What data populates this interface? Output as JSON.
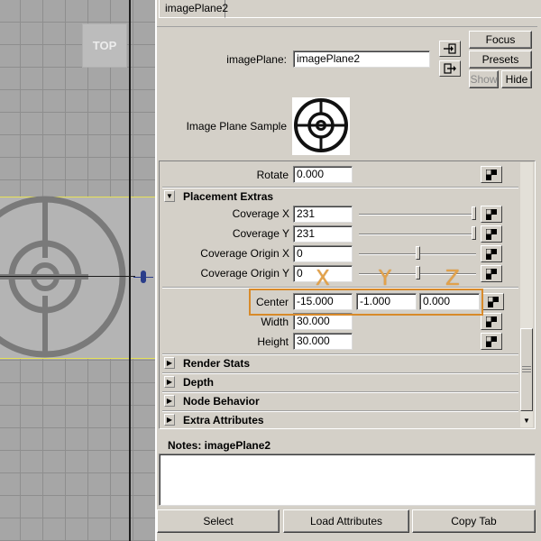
{
  "viewport": {
    "camera_label": "TOP"
  },
  "tab": {
    "label": "imagePlane2"
  },
  "header": {
    "node_label": "imagePlane:",
    "node_value": "imagePlane2",
    "focus_label": "Focus",
    "presets_label": "Presets",
    "show_label": "Show",
    "hide_label": "Hide",
    "sample_label": "Image Plane Sample"
  },
  "attributes": {
    "rotate": {
      "label": "Rotate",
      "value": "0.000"
    },
    "placement_extras": {
      "title": "Placement Extras",
      "expanded": true,
      "rows": [
        {
          "label": "Coverage X",
          "value": "231",
          "slider": 1.0
        },
        {
          "label": "Coverage Y",
          "value": "231",
          "slider": 1.0
        },
        {
          "label": "Coverage Origin X",
          "value": "0",
          "slider": 0.5
        },
        {
          "label": "Coverage Origin Y",
          "value": "0",
          "slider": 0.5
        }
      ]
    },
    "center": {
      "label": "Center",
      "x": "-15.000",
      "y": "-1.000",
      "z": "0.000"
    },
    "width": {
      "label": "Width",
      "value": "30.000"
    },
    "height": {
      "label": "Height",
      "value": "30.000"
    },
    "collapsed_sections": [
      "Render Stats",
      "Depth",
      "Node Behavior",
      "Extra Attributes"
    ]
  },
  "annotation": {
    "color": "#d88a2a",
    "letters": [
      "X",
      "Y",
      "Z"
    ]
  },
  "notes": {
    "label": "Notes:  imagePlane2",
    "value": ""
  },
  "footer": {
    "select_label": "Select",
    "load_label": "Load Attributes",
    "copy_label": "Copy Tab"
  }
}
